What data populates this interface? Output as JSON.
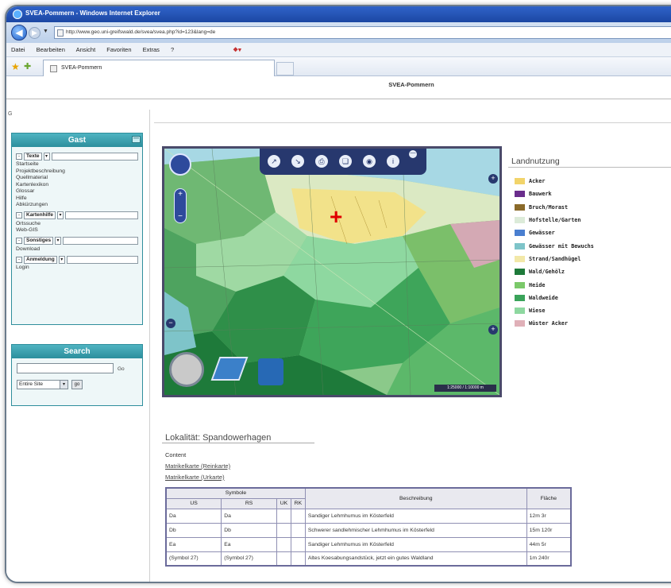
{
  "browser": {
    "title": "SVEA-Pommern - Windows Internet Explorer",
    "url": "http://www.geo.uni-greifswald.de/svea/svea.php?id=123&lang=de",
    "menu": [
      "Datei",
      "Bearbeiten",
      "Ansicht",
      "Favoriten",
      "Extras",
      "?"
    ],
    "tab_label": "SVEA-Pommern"
  },
  "page": {
    "header_title": "SVEA-Pommern",
    "corner_label": "G"
  },
  "gast_panel": {
    "title": "Gast",
    "rows": [
      {
        "select": "Texte",
        "links": [
          "Startseite",
          "Projektbeschreibung",
          "Quellmaterial",
          "Kartenlexikon",
          "Glossar",
          "Hilfe",
          "Abkürzungen"
        ]
      },
      {
        "select": "Kartenhilfe",
        "links": [
          "Ortssuche",
          "Web-GIS"
        ]
      },
      {
        "select": "Sonstiges",
        "links": [
          "Download"
        ]
      },
      {
        "select": "Anmeldung",
        "links": [
          "Login"
        ]
      }
    ]
  },
  "search_panel": {
    "title": "Search",
    "go_label": "Go",
    "scope": "Entire Site",
    "submit_label": "go"
  },
  "legend": {
    "title": "Landnutzung",
    "items": [
      {
        "label": "Acker",
        "color": "#f2d46a"
      },
      {
        "label": "Bauwerk",
        "color": "#6a2d8c"
      },
      {
        "label": "Bruch/Morast",
        "color": "#8a6a2a"
      },
      {
        "label": "Hofstelle/Garten",
        "color": "#dcebd9"
      },
      {
        "label": "Gewässer",
        "color": "#4a7fd0"
      },
      {
        "label": "Gewässer mit Bewuchs",
        "color": "#7ec4c9"
      },
      {
        "label": "Strand/Sandhügel",
        "color": "#f2e8a8"
      },
      {
        "label": "Wald/Gehölz",
        "color": "#1e7a3a"
      },
      {
        "label": "Heide",
        "color": "#7bc96a"
      },
      {
        "label": "Waldweide",
        "color": "#3aa35a"
      },
      {
        "label": "Wiese",
        "color": "#8ed8a0"
      },
      {
        "label": "Wüster Acker",
        "color": "#e0b0b8"
      }
    ]
  },
  "map": {
    "scale": "1:25000 / 1:10000 m"
  },
  "lokalitaet": {
    "title": "Lokalität: Spandowerhagen",
    "content_label": "Content",
    "links": [
      "Matrikelkarte (Reinkarte)",
      "Matrikelkarte (Urkarte)"
    ]
  },
  "table": {
    "symbole_header": "Symbole",
    "sub_headers": [
      "US",
      "RS",
      "UK",
      "RK"
    ],
    "desc_header": "Beschreibung",
    "area_header": "Fläche",
    "rows": [
      {
        "us": "Da",
        "rs": "Da",
        "uk": "",
        "rk": "",
        "desc": "Sandiger Lehmhumus im Kösterfeld",
        "area": "12m 3r"
      },
      {
        "us": "Db",
        "rs": "Db",
        "uk": "",
        "rk": "",
        "desc": "Schwerer sandlehmischer Lehmhumus im Kösterfeld",
        "area": "15m 120r"
      },
      {
        "us": "Ea",
        "rs": "Ea",
        "uk": "",
        "rk": "",
        "desc": "Sandiger Lehmhumus im Kösterfeld",
        "area": "44m 5r"
      },
      {
        "us": "(Symbol 27)",
        "rs": "(Symbol 27)",
        "uk": "",
        "rk": "",
        "desc": "Altes Koesabungsandstück, jetzt ein gutes Waldland",
        "area": "1m 240r"
      }
    ]
  }
}
